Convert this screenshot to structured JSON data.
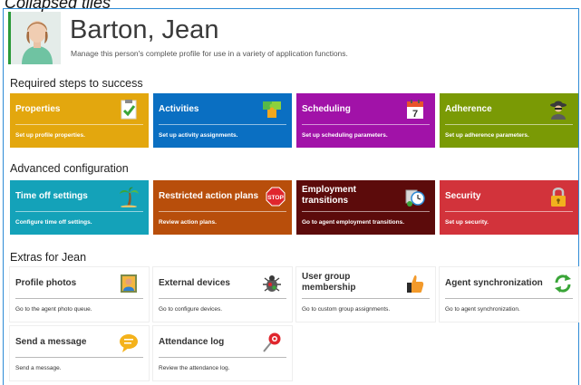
{
  "caption": "Collapsed tiles",
  "person": {
    "name": "Barton, Jean",
    "description": "Manage this person's complete profile for use in a variety of application functions."
  },
  "sections": {
    "required": "Required steps to success",
    "advanced": "Advanced configuration",
    "extras": "Extras for Jean"
  },
  "colors": {
    "frame": "#2e8bd6",
    "properties": "#e3a70e",
    "activities": "#0a6fc2",
    "scheduling": "#a112a8",
    "adherence": "#7a9a05",
    "time_off": "#14a2b9",
    "restricted": "#b84e0b",
    "employment": "#5c0b0b",
    "security": "#d2333b"
  },
  "required_tiles": [
    {
      "title": "Properties",
      "desc": "Set up profile properties.",
      "icon": "checklist-icon"
    },
    {
      "title": "Activities",
      "desc": "Set up activity assignments.",
      "icon": "puzzle-icon"
    },
    {
      "title": "Scheduling",
      "desc": "Set up scheduling parameters.",
      "icon": "calendar-icon",
      "calendar_day": "7"
    },
    {
      "title": "Adherence",
      "desc": "Set up adherence parameters.",
      "icon": "spy-icon"
    }
  ],
  "advanced_tiles": [
    {
      "title": "Time off settings",
      "desc": "Configure time off settings.",
      "icon": "palm-tree-icon"
    },
    {
      "title": "Restricted action plans",
      "desc": "Review action plans.",
      "icon": "stop-sign-icon",
      "sign_text": "STOP"
    },
    {
      "title": "Employment transitions",
      "desc": "Go to agent employment transitions.",
      "icon": "clock-transition-icon"
    },
    {
      "title": "Security",
      "desc": "Set up security.",
      "icon": "padlock-icon"
    }
  ],
  "extras_tiles": [
    {
      "title": "Profile photos",
      "desc": "Go to the agent photo queue.",
      "icon": "portrait-icon"
    },
    {
      "title": "External devices",
      "desc": "Go to configure devices.",
      "icon": "bug-icon"
    },
    {
      "title": "User group membership",
      "desc": "Go to custom group assignments.",
      "icon": "thumbs-up-icon"
    },
    {
      "title": "Agent synchronization",
      "desc": "Go to agent synchronization.",
      "icon": "sync-icon"
    },
    {
      "title": "Send a message",
      "desc": "Send a message.",
      "icon": "chat-bubble-icon"
    },
    {
      "title": "Attendance log",
      "desc": "Review the attendance log.",
      "icon": "pushpin-icon"
    }
  ]
}
